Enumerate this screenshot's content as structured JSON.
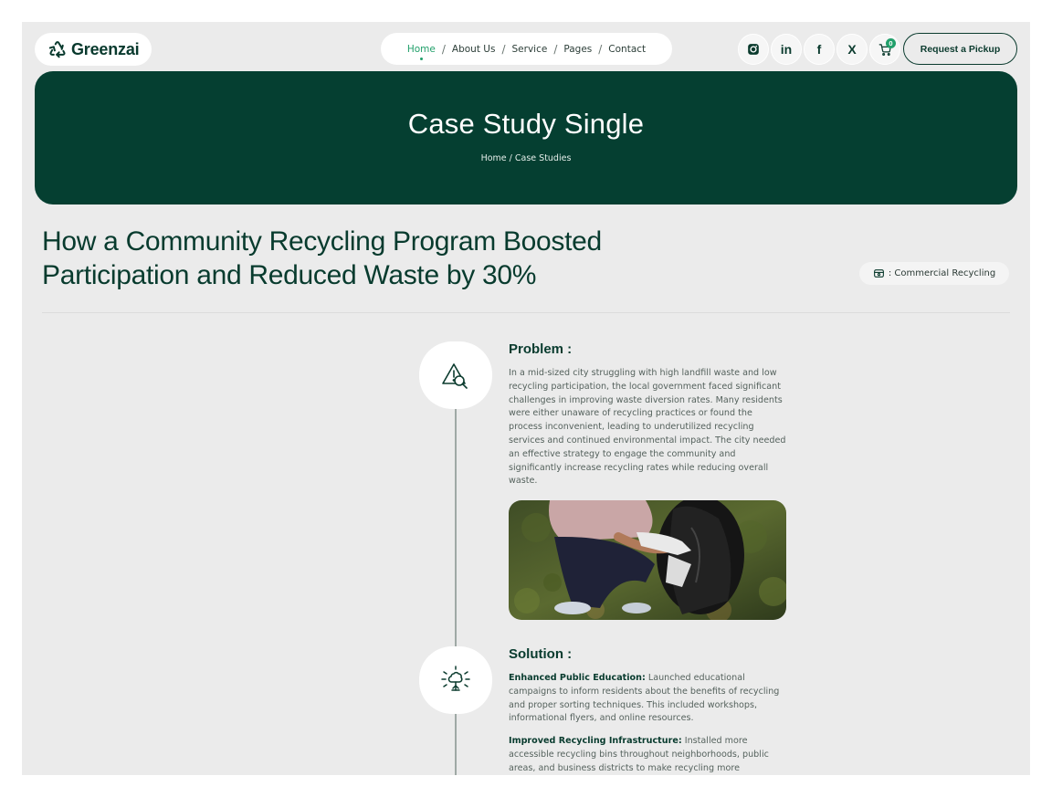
{
  "brand": {
    "name": "Greenzai",
    "icon": "recycle-icon",
    "color": "#053f31",
    "accent": "#22a06b"
  },
  "nav": {
    "items": [
      {
        "label": "Home",
        "active": true
      },
      {
        "label": "About Us"
      },
      {
        "label": "Service"
      },
      {
        "label": "Pages"
      },
      {
        "label": "Contact"
      }
    ],
    "separator": "/"
  },
  "socials": {
    "instagram": "instagram-icon",
    "linkedin": "in",
    "facebook": "f",
    "x": "X",
    "cart_count": "0"
  },
  "cta": {
    "label": "Request a Pickup"
  },
  "hero": {
    "title": "Case Study Single",
    "breadcrumb": "Home / Case Studies"
  },
  "article": {
    "title": "How a Community Recycling Program Boosted Participation and Reduced Waste by 30%",
    "category": ": Commercial Recycling"
  },
  "problem": {
    "title": "Problem :",
    "text": "In a mid-sized city struggling with high landfill waste and low recycling participation, the local government faced significant challenges in improving waste diversion rates. Many residents were either unaware of recycling practices or found the process inconvenient, leading to underutilized recycling services and continued environmental impact. The city needed an effective strategy to engage the community and significantly increase recycling rates while reducing overall waste."
  },
  "solution": {
    "title": "Solution :",
    "points": [
      {
        "heading": "Enhanced Public Education:",
        "text": " Launched educational campaigns to inform residents about the benefits of recycling and proper sorting techniques. This included workshops, informational flyers, and online resources."
      },
      {
        "heading": "Improved Recycling Infrastructure:",
        "text": " Installed more accessible recycling bins throughout neighborhoods, public areas, and business districts to make recycling more"
      }
    ]
  }
}
